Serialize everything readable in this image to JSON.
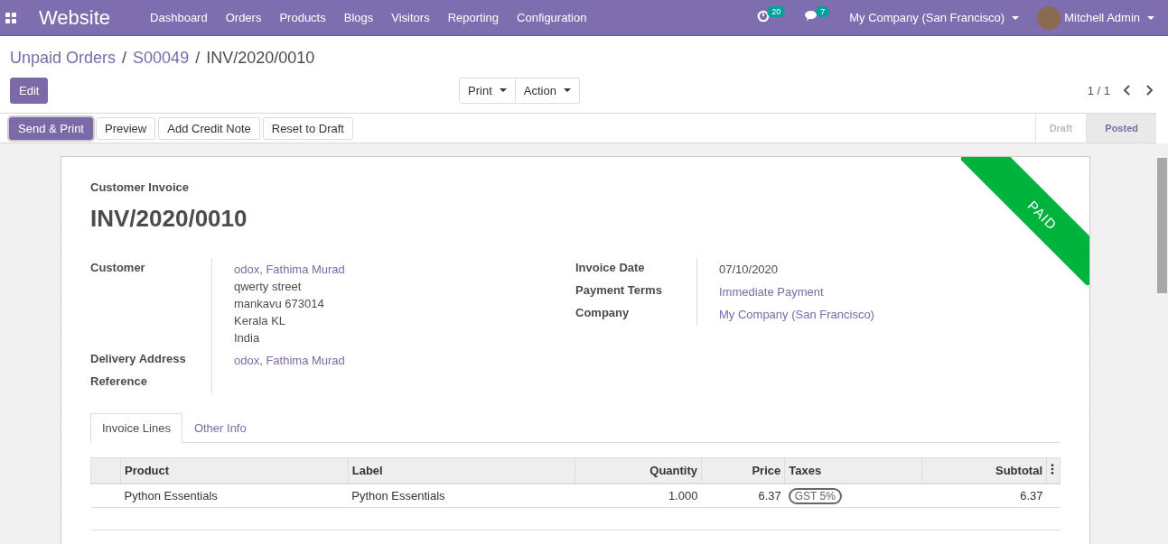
{
  "navbar": {
    "app_name": "Website",
    "menu": [
      "Dashboard",
      "Orders",
      "Products",
      "Blogs",
      "Visitors",
      "Reporting",
      "Configuration"
    ],
    "activity_count": "20",
    "message_count": "7",
    "company": "My Company (San Francisco)",
    "user": "Mitchell Admin"
  },
  "breadcrumbs": [
    {
      "label": "Unpaid Orders",
      "link": true
    },
    {
      "separator": "/",
      "label": "S00049",
      "link": true
    },
    {
      "separator": "/",
      "label": "INV/2020/0010",
      "link": false
    }
  ],
  "edit_button": "Edit",
  "dropdowns": [
    "Print",
    "Action"
  ],
  "pager": "1 / 1",
  "actions": [
    {
      "label": "Send & Print",
      "primary": true
    },
    {
      "label": "Preview",
      "primary": false
    },
    {
      "label": "Add Credit Note",
      "primary": false
    },
    {
      "label": "Reset to Draft",
      "primary": false
    }
  ],
  "statusbar": [
    {
      "label": "Draft",
      "selected": false
    },
    {
      "label": "Posted",
      "selected": true
    }
  ],
  "sheet": {
    "ribbon": "PAID",
    "title_label": "Customer Invoice",
    "title": "INV/2020/0010",
    "left_fields": [
      {
        "label": "Customer",
        "values": [
          {
            "text": "odox, Fathima Murad",
            "link": true
          },
          {
            "text": "qwerty street",
            "link": false
          },
          {
            "text": "mankavu 673014",
            "link": false
          },
          {
            "text": "Kerala KL",
            "link": false
          },
          {
            "text": "India",
            "link": false
          }
        ]
      },
      {
        "label": "Delivery Address",
        "values": [
          {
            "text": "odox, Fathima Murad",
            "link": true
          }
        ]
      },
      {
        "label": "Reference"
      }
    ],
    "right_fields": [
      {
        "label": "Invoice Date",
        "values": [
          {
            "text": "07/10/2020",
            "link": false
          }
        ]
      },
      {
        "label": "Payment Terms",
        "values": [
          {
            "text": "Immediate Payment",
            "link": true
          }
        ]
      },
      {
        "label": "Company",
        "values": [
          {
            "text": "My Company (San Francisco)",
            "link": true
          }
        ]
      }
    ],
    "tabs": [
      {
        "label": "Invoice Lines",
        "selected": true
      },
      {
        "label": "Other Info",
        "selected": false
      }
    ],
    "table": {
      "columns": [
        {
          "label": "Product",
          "kind": "text"
        },
        {
          "label": "Label",
          "kind": "text"
        },
        {
          "label": "Quantity",
          "kind": "number"
        },
        {
          "label": "Price",
          "kind": "number"
        },
        {
          "label": "Taxes",
          "kind": "tags"
        },
        {
          "label": "Subtotal",
          "kind": "number"
        }
      ],
      "rows": [
        {
          "cells": [
            {
              "kind": "text",
              "text": "Python Essentials"
            },
            {
              "kind": "text",
              "text": "Python Essentials"
            },
            {
              "kind": "text",
              "text": "1.000"
            },
            {
              "kind": "text",
              "text": "6.37"
            },
            {
              "kind": "tag",
              "text": "GST 5%"
            },
            {
              "kind": "text",
              "text": "6.37"
            }
          ]
        }
      ]
    }
  }
}
